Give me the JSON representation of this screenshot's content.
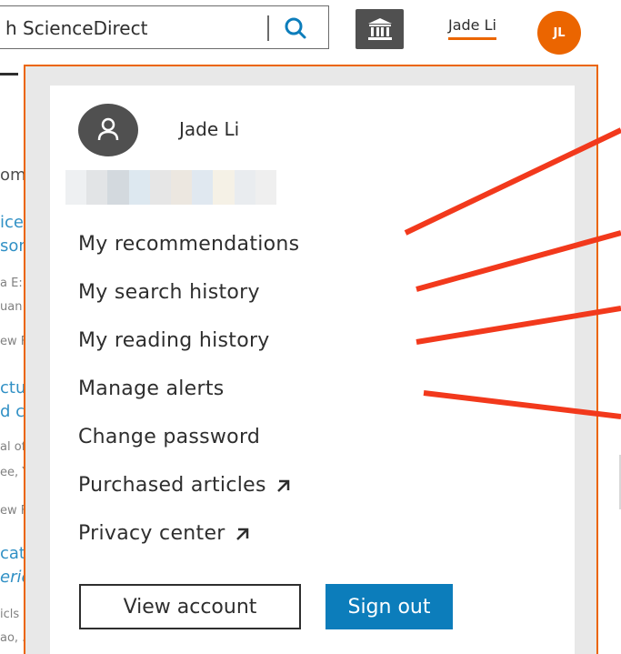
{
  "header": {
    "search_text": "h ScienceDirect",
    "user_name": "Jade Li",
    "avatar_initials": "JL"
  },
  "background_fragments": [
    "om",
    "ice p",
    "son",
    "a E:",
    "uan",
    "ew F",
    "ctur",
    "d cu",
    "al of",
    "ee, Y",
    "ew F",
    "cat",
    "ericl",
    "icls",
    "ao, .."
  ],
  "dropdown": {
    "profile_name": "Jade Li",
    "menu_items": [
      {
        "label": "My recommendations"
      },
      {
        "label": "My search history"
      },
      {
        "label": "My reading history"
      },
      {
        "label": "Manage alerts"
      },
      {
        "label": "Change password"
      },
      {
        "label": "Purchased articles"
      },
      {
        "label": "Privacy center"
      }
    ],
    "view_account_label": "View account",
    "sign_out_label": "Sign out"
  },
  "colors": {
    "accent_orange": "#eb6500",
    "primary_blue": "#0c7dbb",
    "annotation_red": "#f2391c",
    "dark_gray": "#505050"
  }
}
